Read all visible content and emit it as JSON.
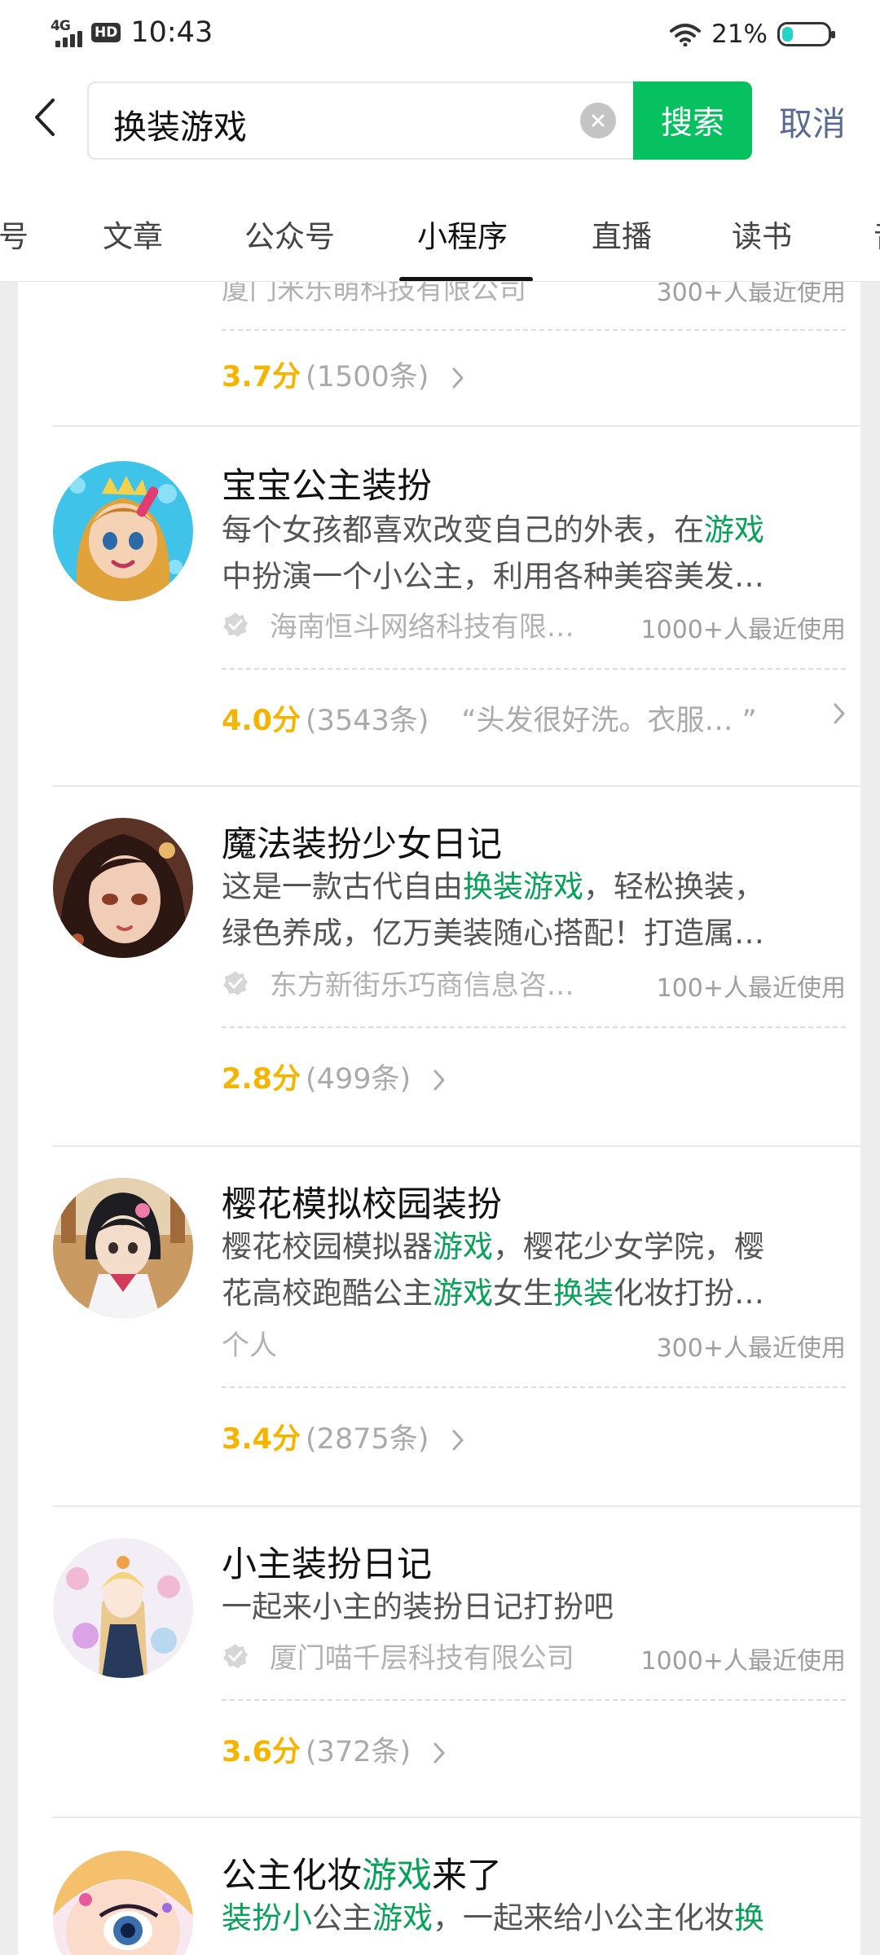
{
  "status_bar": {
    "network": "4G",
    "hd": "HD",
    "time": "10:43",
    "battery": "21%"
  },
  "search": {
    "query": "换装游戏",
    "button": "搜索",
    "cancel": "取消"
  },
  "tabs": [
    {
      "label": "号"
    },
    {
      "label": "文章"
    },
    {
      "label": "公众号"
    },
    {
      "label": "小程序"
    },
    {
      "label": "直播"
    },
    {
      "label": "读书"
    },
    {
      "label": "音"
    }
  ],
  "active_tab": "小程序",
  "results": [
    {
      "org": "厦门米乐萌科技有限公司",
      "usage": "300+人最近使用",
      "score": "3.7分",
      "count": "(1500条)"
    },
    {
      "name": "宝宝公主装扮",
      "desc_line1_a": "每个女孩都喜欢改变自己的外表，在",
      "desc_line1_b": "游戏",
      "desc_line2": "中扮演一个小公主，利用各种美容美发…",
      "org": "海南恒斗网络科技有限…",
      "usage": "1000+人最近使用",
      "score": "4.0分",
      "count": "(3543条)",
      "quote": "“头发很好洗。衣服… ”"
    },
    {
      "name": "魔法装扮少女日记",
      "desc_line1_a": "这是一款古代自由",
      "desc_line1_b": "换装游戏",
      "desc_line1_c": "，轻松换装，",
      "desc_line2": "绿色养成，亿万美装随心搭配！打造属…",
      "org": "东方新街乐巧商信息咨…",
      "usage": "100+人最近使用",
      "score": "2.8分",
      "count": "(499条)"
    },
    {
      "name": "樱花模拟校园装扮",
      "desc_line1_a": "樱花校园模拟器",
      "desc_line1_b": "游戏",
      "desc_line1_c": "，樱花少女学院，樱",
      "desc_line2_a": "花高校跑酷公主",
      "desc_line2_b": "游戏",
      "desc_line2_c": "女生",
      "desc_line2_d": "换装",
      "desc_line2_e": "化妆打扮…",
      "org": "个人",
      "usage": "300+人最近使用",
      "score": "3.4分",
      "count": "(2875条)"
    },
    {
      "name": "小主装扮日记",
      "desc_line1": "一起来小主的装扮日记打扮吧",
      "org": "厦门喵千层科技有限公司",
      "usage": "1000+人最近使用",
      "score": "3.6分",
      "count": "(372条)"
    },
    {
      "name_a": "公主化妆",
      "name_b": "游戏",
      "name_c": "来了",
      "desc_line1_a": "装扮",
      "desc_line1_b": "小",
      "desc_line1_c": "公主",
      "desc_line1_d": "游戏",
      "desc_line1_e": "，一起来给小公主化妆",
      "desc_line1_f": "换"
    }
  ],
  "colors": {
    "accent_green": "#07c160",
    "highlight_green": "#07a157",
    "score_yellow": "#f5b400",
    "cancel_blue": "#576b95"
  }
}
